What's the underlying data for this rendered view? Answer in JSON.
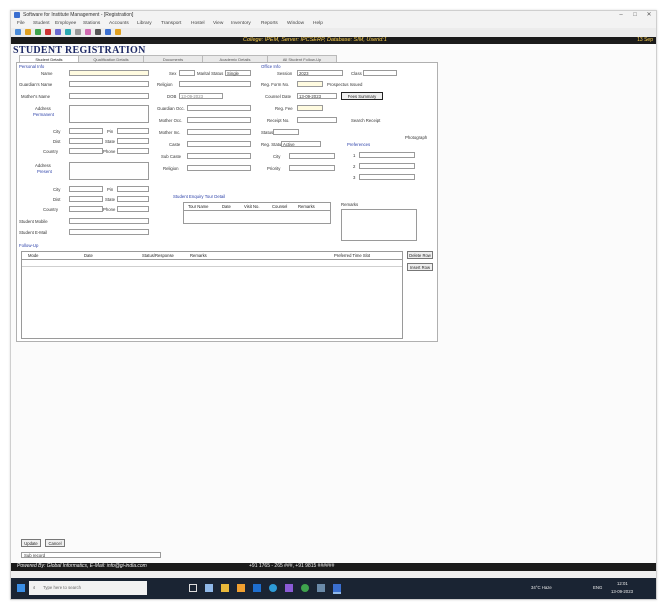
{
  "window": {
    "title": "Software for Institute Management - [Registration]",
    "controls": [
      "–",
      "□",
      "✕"
    ]
  },
  "menu": [
    "File",
    "Student",
    "Employee",
    "Stations",
    "Accounts",
    "Library",
    "Transport",
    "Hostel",
    "View",
    "Inventory",
    "Reports",
    "Window",
    "Help"
  ],
  "infobar": {
    "text": "College: IPEM, Server: IPCSERP, Database: SIM, Userid:1",
    "right": "13 Sep"
  },
  "heading": "STUDENT REGISTRATION",
  "tabs": [
    "Student Details",
    "Qualification Details",
    "Documents",
    "Academic Details",
    "All Student Follow-Up"
  ],
  "personal": {
    "section": "Personal Info",
    "name": "Name",
    "guardian": "Guardian's Name",
    "mother": "Mother's Name",
    "address": "Address",
    "permanent": "Permanent",
    "city": "City",
    "dist": "Dist",
    "country": "Country",
    "pin": "Pin",
    "state": "State",
    "phone": "Phone",
    "address2": "Address",
    "present": "Present",
    "mobile": "Student Mobile",
    "email": "Student E-Mail"
  },
  "demo": {
    "sex": "Sex",
    "marital": "Marital Status",
    "marital_val": "Single",
    "religion": "Religion",
    "dob": "DOB",
    "dob_val": "13-09-2023",
    "guardian_occ": "Guardian Occ.",
    "mother_occ": "Mother Occ.",
    "mother_income": "Mother Inc.",
    "caste": "Caste",
    "sub_caste": "Sub Caste",
    "religion2": "Religion"
  },
  "college": {
    "section": "Office Info",
    "session": "Session",
    "session_val": "2023",
    "class": "Class",
    "reg_form_no": "Reg. Form No.",
    "prospectus": "Prospectus Issued",
    "counsel_date": "Counsel Date",
    "counsel_val": "13-09-2023",
    "fee_summary": "Fees Summary",
    "reg_fee": "Reg. Fee",
    "receipt_no": "Receipt No.",
    "search_receipt": "Search Receipt",
    "status": "Status",
    "reg_status": "Reg. Status",
    "reg_status_val": "Active",
    "city": "City",
    "priority": "Priority",
    "photograph": "Photograph",
    "preferences": "Preferences",
    "pref_1": "1",
    "pref_2": "2",
    "pref_3": "3"
  },
  "interaction": {
    "section": "Student Enquiry Tour Detail",
    "headers": [
      "Tour Name",
      "Date",
      "Visit No.",
      "Counsel",
      "Remarks"
    ],
    "remarks": "Remarks"
  },
  "followup": {
    "section": "Follow-Up",
    "headers": [
      "Mode",
      "Date",
      "Status/Response",
      "Remarks",
      "Preferred Time Slot"
    ],
    "delete": "Delete Row",
    "insert": "Insert Row"
  },
  "bottom": {
    "update": "Update",
    "cancel": "Cancel",
    "subrecord": "Sub record"
  },
  "statusbar": {
    "powered": "Powered By: Global Informatics, E-Mail: info@gi-india.com",
    "phone": "+91 1765 - 265 ###, +91 9815 ######"
  },
  "taskbar": {
    "search": "Type here to search",
    "weather": "34°C Haze",
    "lang": "ENG",
    "time": "12:01",
    "date": "13-09-2023"
  },
  "colors": {
    "info": "#ffd24d",
    "heading": "#1e2a66",
    "dark": "#1b1b1b",
    "task": "#1a2433"
  }
}
